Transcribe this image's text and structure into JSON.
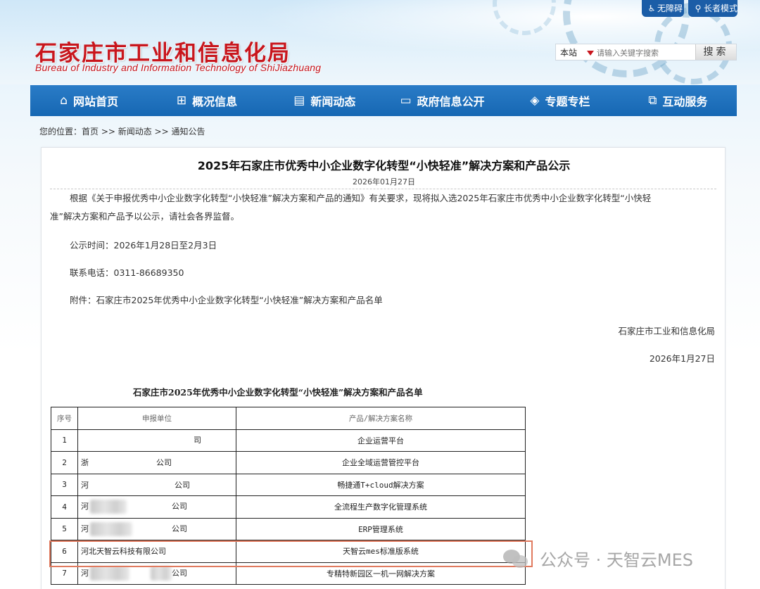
{
  "header": {
    "logo_cn": "石家庄市工业和信息化局",
    "logo_en": "Bureau of Industry and Information Technology of ShiJiazhuang",
    "accessibility": {
      "label": "无障碍",
      "icon": "wheelchair-icon"
    },
    "elder_mode": {
      "label": "长者模式",
      "icon": "elder-icon"
    },
    "search": {
      "scope": "本站",
      "placeholder": "请输入关键字搜索",
      "button": "搜索"
    }
  },
  "nav": [
    {
      "label": "网站首页",
      "icon": "home-icon"
    },
    {
      "label": "概况信息",
      "icon": "grid-icon"
    },
    {
      "label": "新闻动态",
      "icon": "news-icon"
    },
    {
      "label": "政府信息公开",
      "icon": "chat-icon"
    },
    {
      "label": "专题专栏",
      "icon": "layers-icon"
    },
    {
      "label": "互动服务",
      "icon": "interact-icon"
    }
  ],
  "breadcrumb": "您的位置：首页 >> 新闻动态 >> 通知公告",
  "article": {
    "title": "2025年石家庄市优秀中小企业数字化转型“小快轻准”解决方案和产品公示",
    "date": "2026年01月27日",
    "para1_line1": "根据《关于申报优秀中小企业数字化转型“小快轻准”解决方案和产品的通知》有关要求，现将拟入选2025年石家庄市优秀中小企业数字化转型“小快轻",
    "para1_line2": "准”解决方案和产品予以公示，请社会各界监督。",
    "period": "公示时间：2026年1月28日至2月3日",
    "phone": "联系电话：0311-86689350",
    "attachment": "附件：石家庄市2025年优秀中小企业数字化转型“小快轻准”解决方案和产品名单",
    "signature": "石家庄市工业和信息化局",
    "sign_date": "2026年1月27日"
  },
  "table": {
    "caption": "石家庄市2025年优秀中小企业数字化转型“小快轻准”解决方案和产品名单",
    "headers": [
      "序号",
      "申报单位",
      "产品/解决方案名称"
    ],
    "rows": [
      {
        "no": "1",
        "unit_prefix": "",
        "unit_suffix": "司",
        "product": "企业运营平台"
      },
      {
        "no": "2",
        "unit_prefix": "浙",
        "unit_suffix": "公司",
        "product": "企业全域运营管控平台"
      },
      {
        "no": "3",
        "unit_prefix": "河",
        "unit_suffix": "公司",
        "product": "畅捷通T+cloud解决方案"
      },
      {
        "no": "4",
        "unit_prefix": "河",
        "unit_suffix": "公司",
        "product": "全流程生产数字化管理系统"
      },
      {
        "no": "5",
        "unit_prefix": "河",
        "unit_suffix": "公司",
        "product": "ERP管理系统"
      },
      {
        "no": "6",
        "unit_prefix": "河北天智云科技有限公司",
        "unit_suffix": "",
        "product": "天智云mes标准版系统"
      },
      {
        "no": "7",
        "unit_prefix": "河",
        "unit_suffix": "公司",
        "product": "专精特新园区一机一网解决方案"
      }
    ]
  },
  "watermark": "公众号 · 天智云MES",
  "colors": {
    "brand_red": "#c8161d",
    "nav_blue": "#1b6ab5",
    "highlight": "#e07a5f"
  }
}
